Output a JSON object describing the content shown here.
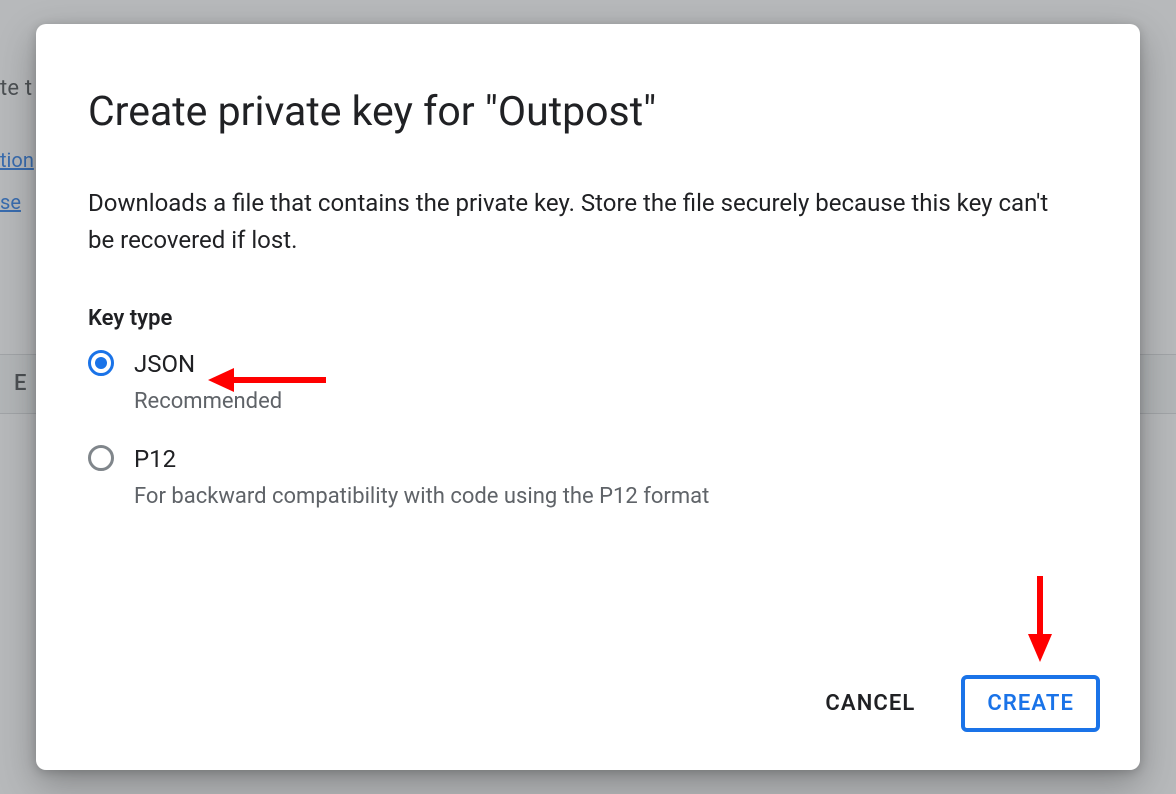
{
  "background": {
    "text_fragment": "te t",
    "link_a": "tion",
    "link_b": "se",
    "row_label": "E"
  },
  "dialog": {
    "title": "Create private key for \"Outpost\"",
    "description": "Downloads a file that contains the private key. Store the file securely because this key can't be recovered if lost.",
    "group_label": "Key type",
    "options": [
      {
        "value": "json",
        "label": "JSON",
        "sub": "Recommended",
        "selected": true
      },
      {
        "value": "p12",
        "label": "P12",
        "sub": "For backward compatibility with code using the P12 format",
        "selected": false
      }
    ],
    "cancel_label": "CANCEL",
    "create_label": "CREATE"
  },
  "colors": {
    "primary": "#1a73e8",
    "scrim": "rgba(95,99,104,0.45)",
    "annotation": "#ff0000"
  }
}
